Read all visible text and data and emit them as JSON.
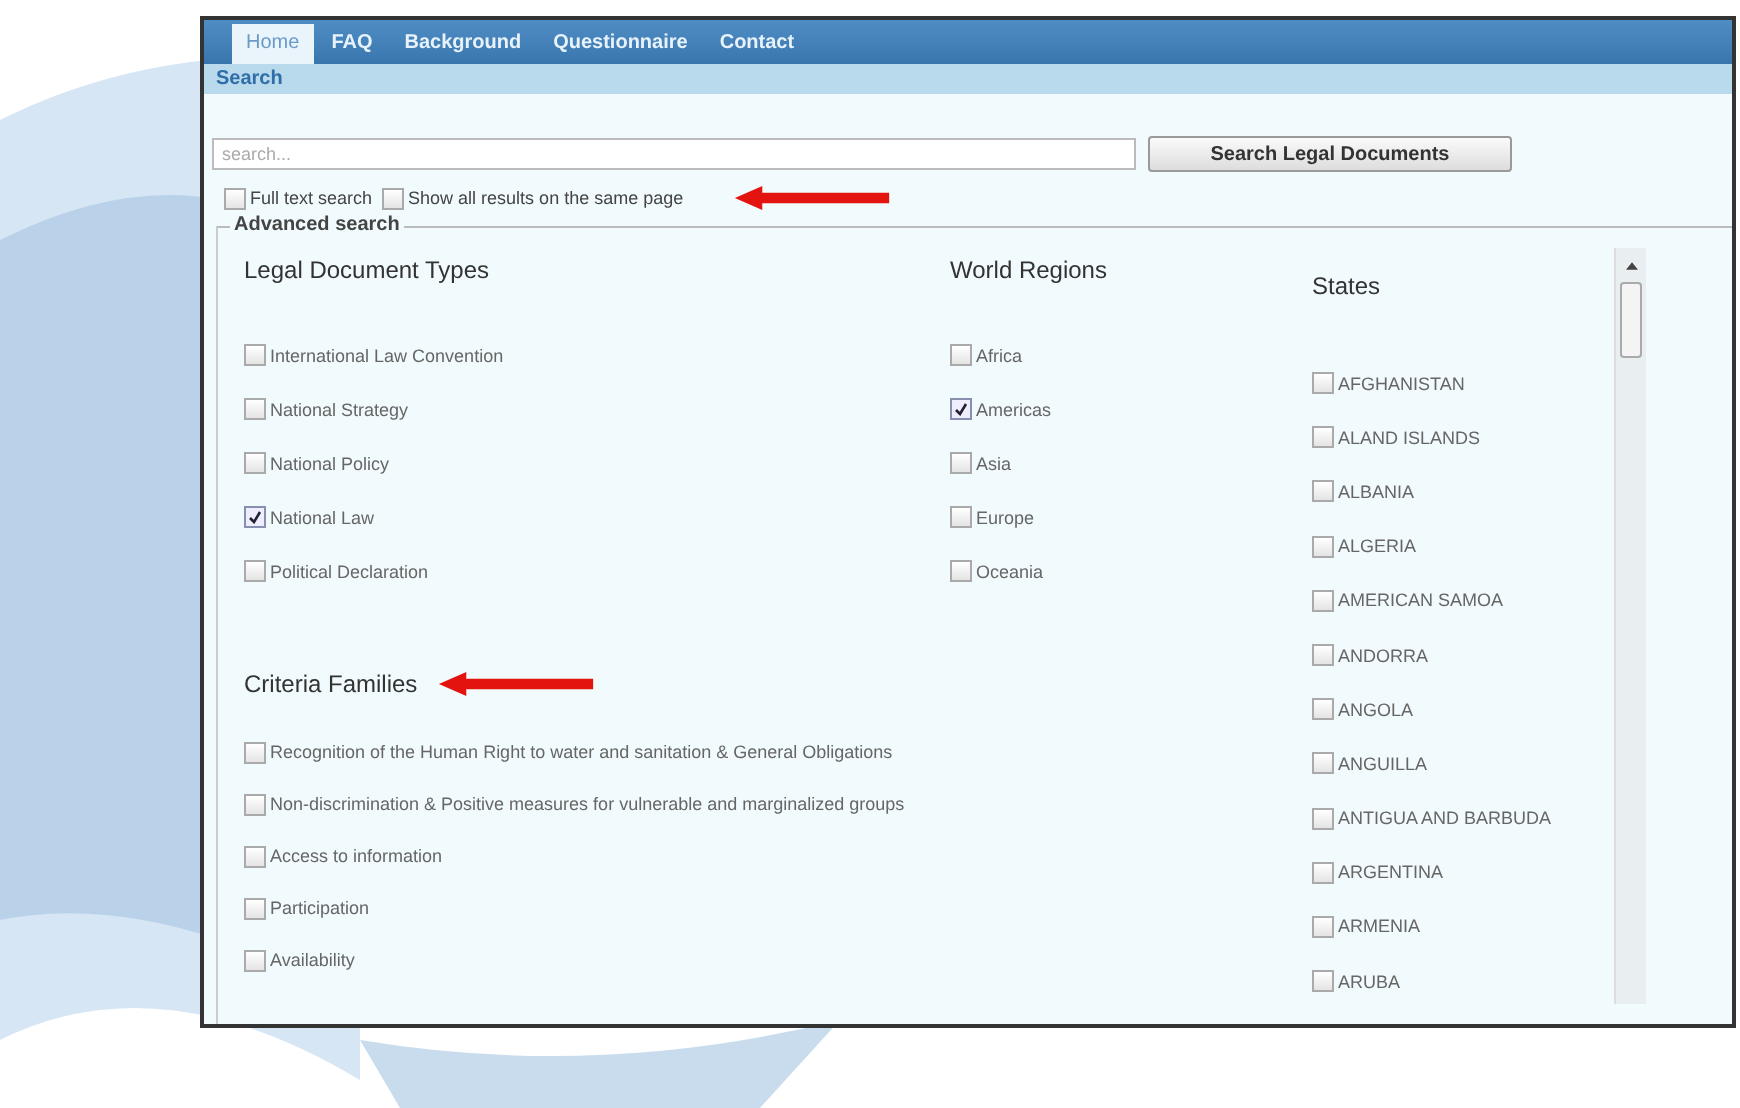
{
  "tabs": [
    {
      "label": "Home",
      "selected": true
    },
    {
      "label": "FAQ",
      "selected": false
    },
    {
      "label": "Background",
      "selected": false
    },
    {
      "label": "Questionnaire",
      "selected": false
    },
    {
      "label": "Contact",
      "selected": false
    }
  ],
  "subnav": {
    "label": "Search"
  },
  "search": {
    "placeholder": "search...",
    "button": "Search Legal Documents"
  },
  "options": [
    {
      "label": "Full text search",
      "checked": false
    },
    {
      "label": "Show all results on the same page",
      "checked": false
    }
  ],
  "advanced": {
    "legend": "Advanced search",
    "document_types": {
      "title": "Legal Document Types",
      "items": [
        {
          "label": "International Law Convention",
          "checked": false
        },
        {
          "label": "National Strategy",
          "checked": false
        },
        {
          "label": "National Policy",
          "checked": false
        },
        {
          "label": "National Law",
          "checked": true
        },
        {
          "label": "Political Declaration",
          "checked": false
        }
      ]
    },
    "world_regions": {
      "title": "World Regions",
      "items": [
        {
          "label": "Africa",
          "checked": false
        },
        {
          "label": "Americas",
          "checked": true
        },
        {
          "label": "Asia",
          "checked": false
        },
        {
          "label": "Europe",
          "checked": false
        },
        {
          "label": "Oceania",
          "checked": false
        }
      ]
    },
    "states": {
      "title": "States",
      "items": [
        {
          "label": "AFGHANISTAN",
          "checked": false
        },
        {
          "label": "ALAND ISLANDS",
          "checked": false
        },
        {
          "label": "ALBANIA",
          "checked": false
        },
        {
          "label": "ALGERIA",
          "checked": false
        },
        {
          "label": "AMERICAN SAMOA",
          "checked": false
        },
        {
          "label": "ANDORRA",
          "checked": false
        },
        {
          "label": "ANGOLA",
          "checked": false
        },
        {
          "label": "ANGUILLA",
          "checked": false
        },
        {
          "label": "ANTIGUA AND BARBUDA",
          "checked": false
        },
        {
          "label": "ARGENTINA",
          "checked": false
        },
        {
          "label": "ARMENIA",
          "checked": false
        },
        {
          "label": "ARUBA",
          "checked": false
        }
      ]
    },
    "criteria_families": {
      "title": "Criteria Families",
      "items": [
        {
          "label": "Recognition of the Human Right to water and sanitation & General Obligations",
          "checked": false
        },
        {
          "label": "Non-discrimination & Positive measures for vulnerable and marginalized groups",
          "checked": false
        },
        {
          "label": "Access to information",
          "checked": false
        },
        {
          "label": "Participation",
          "checked": false
        },
        {
          "label": "Availability",
          "checked": false
        }
      ]
    }
  }
}
